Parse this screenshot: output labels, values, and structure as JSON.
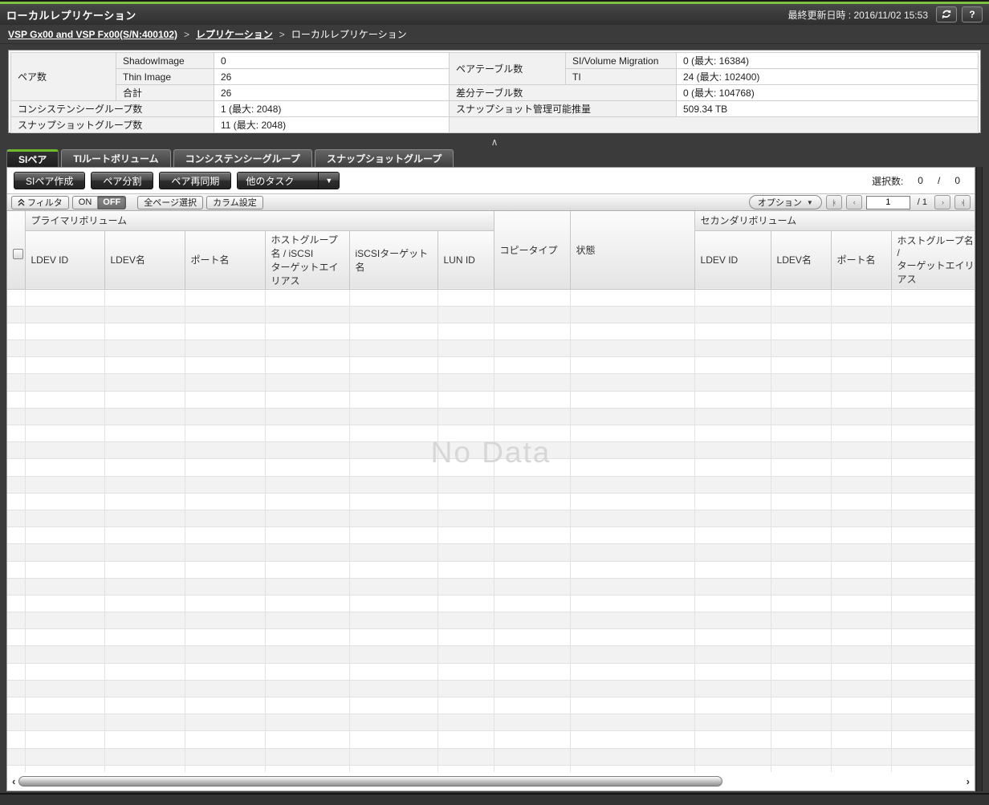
{
  "titlebar": {
    "title": "ローカルレプリケーション",
    "last_updated": "最終更新日時 : 2016/11/02 15:53",
    "help_label": "?"
  },
  "breadcrumb": {
    "items": [
      "VSP Gx00 and VSP Fx00(S/N:400102)",
      "レプリケーション",
      "ローカルレプリケーション"
    ],
    "separator": ">"
  },
  "summary": {
    "pair_count": {
      "label": "ペア数",
      "rows": [
        {
          "name": "ShadowImage",
          "value": "0"
        },
        {
          "name": "Thin Image",
          "value": "26"
        },
        {
          "name": "合計",
          "value": "26"
        }
      ]
    },
    "consistency_groups": {
      "label": "コンシステンシーグループ数",
      "value": "1 (最大: 2048)"
    },
    "snapshot_groups": {
      "label": "スナップショットグループ数",
      "value": "11 (最大: 2048)"
    },
    "pair_tables": {
      "label": "ペアテーブル数",
      "rows": [
        {
          "name": "SI/Volume Migration",
          "value": "0 (最大: 16384)"
        },
        {
          "name": "TI",
          "value": "24 (最大: 102400)"
        }
      ]
    },
    "diff_tables": {
      "label": "差分テーブル数",
      "value": "0 (最大: 104768)"
    },
    "snapshot_capacity": {
      "label": "スナップショット管理可能推量",
      "value": "509.34 TB"
    }
  },
  "collapse": {
    "icon": "∧"
  },
  "tabs": [
    {
      "label": "SIペア"
    },
    {
      "label": "TIルートボリューム"
    },
    {
      "label": "コンシステンシーグループ"
    },
    {
      "label": "スナップショットグループ"
    }
  ],
  "toolbar": {
    "create_button": "SIペア作成",
    "split_button": "ペア分割",
    "resync_button": "ペア再同期",
    "other_tasks_button": "他のタスク",
    "dropdown_caret": "▼",
    "selection_label": "選択数:",
    "selected_count": "0",
    "selection_divider": "/",
    "total_count": "0"
  },
  "filterbar": {
    "filter_button": "フィルタ",
    "on_label": "ON",
    "off_label": "OFF",
    "select_all_pages_button": "全ページ選択",
    "column_settings_button": "カラム設定",
    "options_button": "オプション",
    "options_caret": "▼",
    "first_page": "|‹",
    "prev_page": "‹",
    "page_value": "1",
    "page_total": "/ 1",
    "next_page": "›",
    "last_page": "›|"
  },
  "table": {
    "primary_group": "プライマリボリューム",
    "secondary_group": "セカンダリボリューム",
    "copy_type": "コピータイプ",
    "status": "状態",
    "primary_columns": [
      "LDEV ID",
      "LDEV名",
      "ポート名",
      "ホストグループ名 / iSCSI\nターゲットエイリアス",
      "iSCSIターゲット名",
      "LUN ID"
    ],
    "secondary_columns": [
      "LDEV ID",
      "LDEV名",
      "ポート名",
      "ホストグループ名 /\nターゲットエイリアス"
    ],
    "empty_message": "No Data"
  },
  "hscrollbar": {
    "left_arrow": "‹",
    "right_arrow": "›"
  }
}
